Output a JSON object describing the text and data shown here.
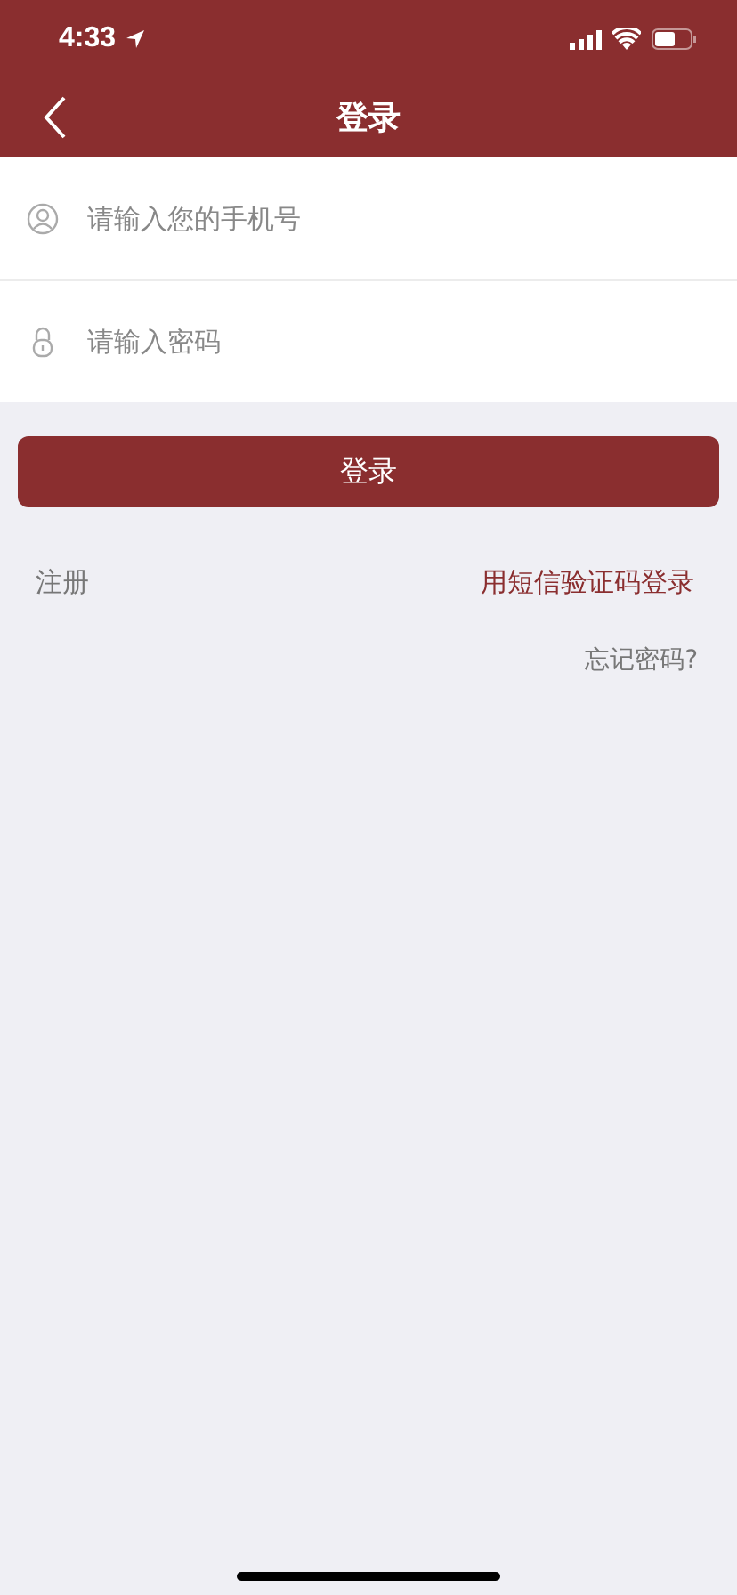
{
  "status_bar": {
    "time": "4:33"
  },
  "nav": {
    "title": "登录"
  },
  "fields": [
    {
      "kind": "phone",
      "placeholder": "请输入您的手机号"
    },
    {
      "kind": "password",
      "placeholder": "请输入密码"
    }
  ],
  "login_button": "登录",
  "links": {
    "register": "注册",
    "sms_login": "用短信验证码登录",
    "forgot": "忘记密码?"
  }
}
